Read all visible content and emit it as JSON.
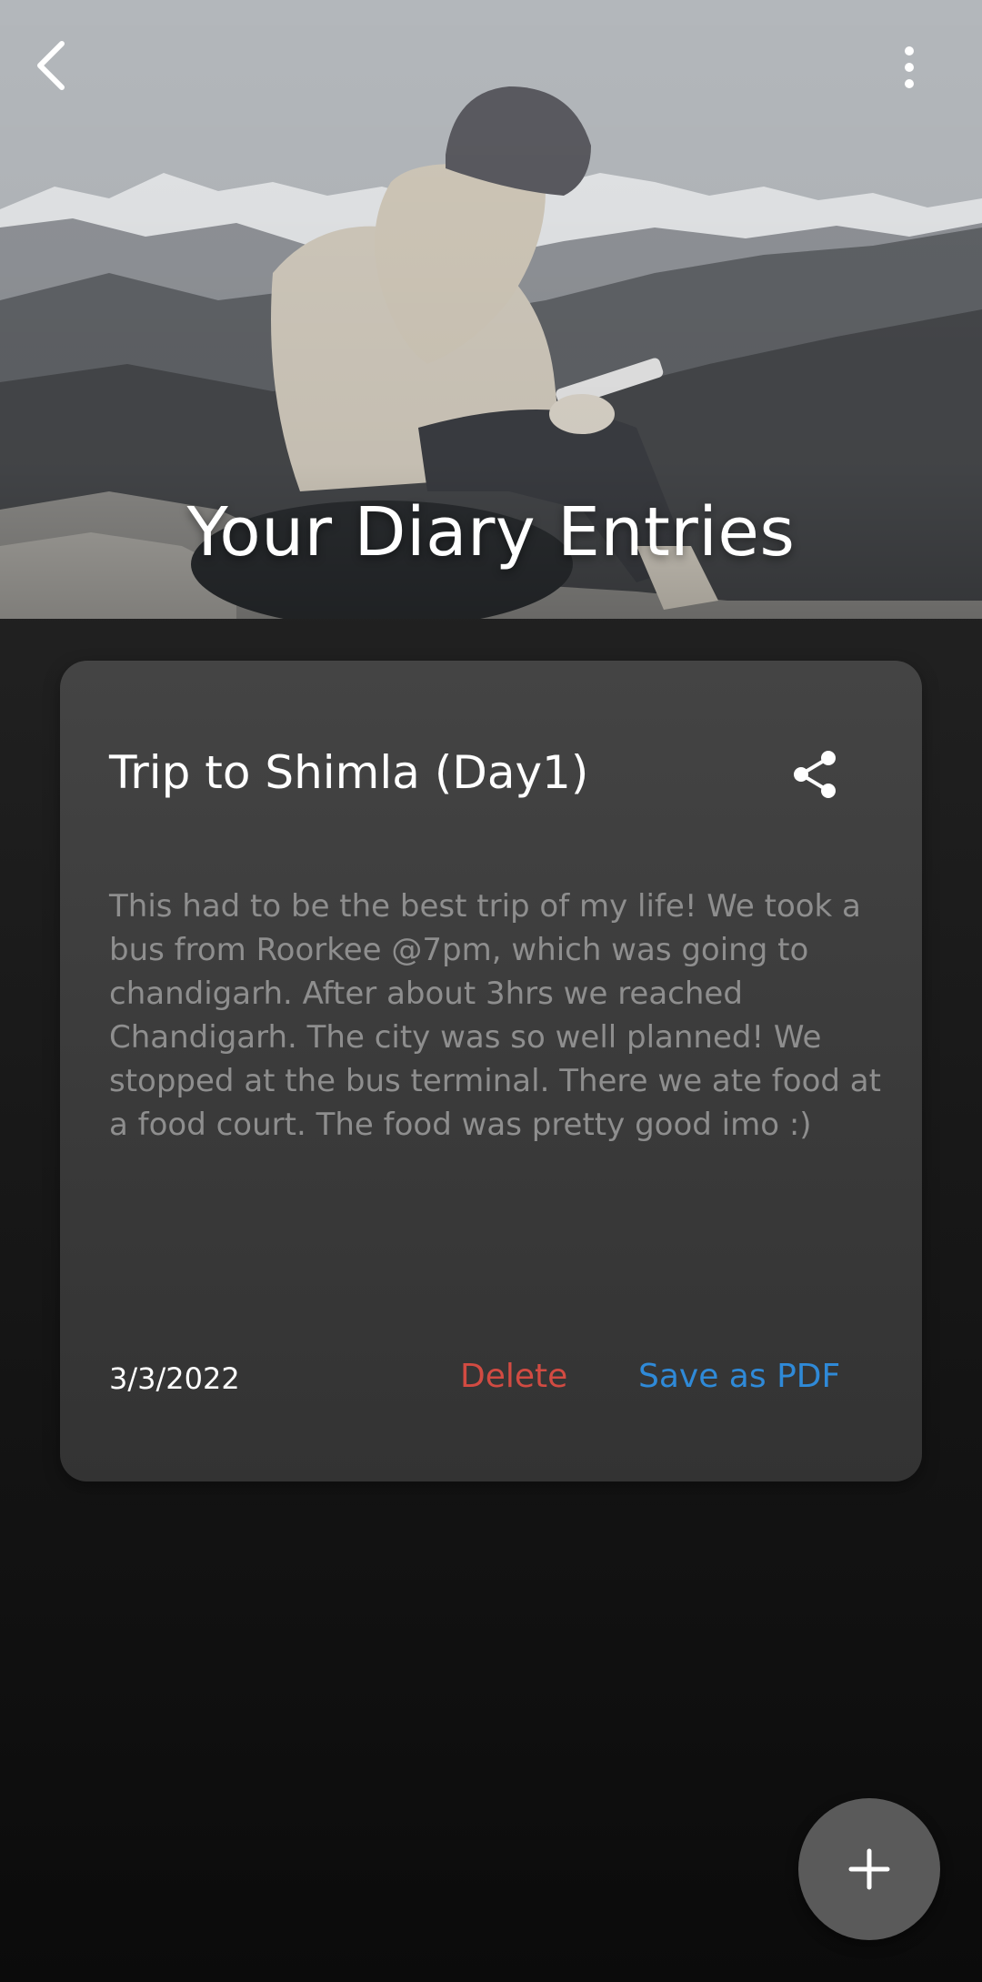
{
  "header": {
    "title": "Your Diary Entries",
    "icons": {
      "back": "chevron-left-icon",
      "more": "more-vertical-icon"
    },
    "background": "mountain-landscape-photo"
  },
  "entries": [
    {
      "title": "Trip to Shimla (Day1)",
      "body": "This had to be the best trip of my life! We took a bus from Roorkee @7pm, which was going to chandigarh. After about 3hrs we reached Chandigarh. The city was so well planned! We stopped at the bus terminal. There we ate food at a food court. The food was pretty good imo :)",
      "date": "3/3/2022",
      "actions": {
        "delete_label": "Delete",
        "save_pdf_label": "Save as PDF"
      }
    }
  ],
  "fab": {
    "icon": "plus-icon"
  },
  "colors": {
    "delete": "#d24b42",
    "save_pdf": "#2f8ad8",
    "card": "#3d3d3d",
    "fab": "#5a5a5a"
  }
}
